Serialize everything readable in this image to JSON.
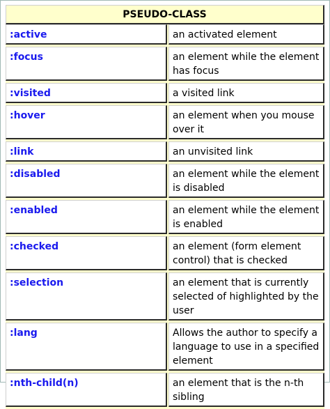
{
  "table": {
    "header": "PSEUDO-CLASS",
    "rows": [
      {
        "selector": ":active",
        "description": "an activated element"
      },
      {
        "selector": ":focus",
        "description": "an element while the element has focus"
      },
      {
        "selector": ":visited",
        "description": "a visited link"
      },
      {
        "selector": ":hover",
        "description": "an element when you mouse over it"
      },
      {
        "selector": ":link",
        "description": "an unvisited link"
      },
      {
        "selector": ":disabled",
        "description": "an element while the element is disabled"
      },
      {
        "selector": ":enabled",
        "description": "an element while the element is enabled"
      },
      {
        "selector": ":checked",
        "description": "an element (form element control) that is checked"
      },
      {
        "selector": ":selection",
        "description": "an element that is currently selected of highlighted by the user"
      },
      {
        "selector": ":lang",
        "description": "Allows the author to specify a language to use in a specified element"
      },
      {
        "selector": ":nth-child(n)",
        "description": "an element that is the n-th sibling"
      }
    ]
  },
  "colors": {
    "header_background": "#ffffcc",
    "selector_text": "#1a1aee"
  }
}
